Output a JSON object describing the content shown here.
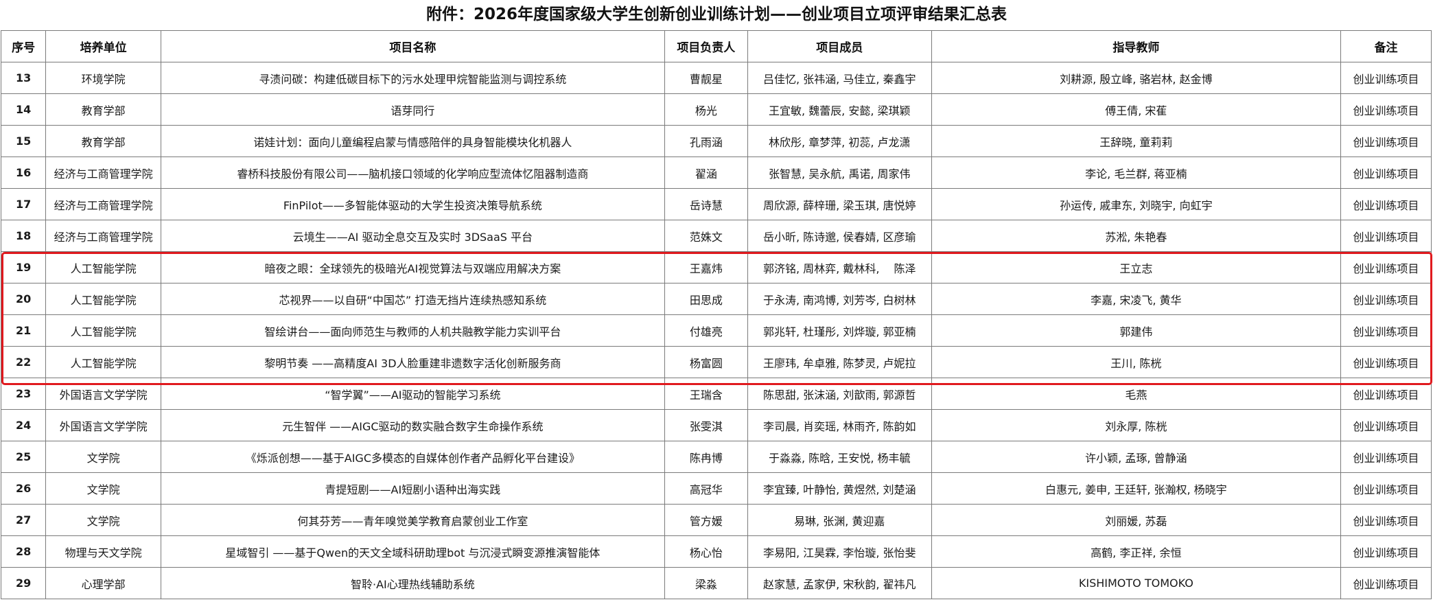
{
  "title": "附件：2026年度国家级大学生创新创业训练计划——创业项目立项评审结果汇总表",
  "headers": [
    "序号",
    "培养单位",
    "项目名称",
    "项目负责人",
    "项目成员",
    "指导教师",
    "备注"
  ],
  "rows": [
    {
      "seq": "13",
      "unit": "环境学院",
      "project": "寻渍问碳：构建低碳目标下的污水处理甲烷智能监测与调控系统",
      "leader": "曹靓星",
      "members": "吕佳忆, 张祎涵, 马佳立, 秦鑫宇",
      "advisors": "刘耕源, 殷立峰, 骆岩林, 赵金博",
      "remark": "创业训练项目"
    },
    {
      "seq": "14",
      "unit": "教育学部",
      "project": "语芽同行",
      "leader": "杨光",
      "members": "王宜敏, 魏蕾辰, 安懿, 梁琪颖",
      "advisors": "傅王倩, 宋萑",
      "remark": "创业训练项目"
    },
    {
      "seq": "15",
      "unit": "教育学部",
      "project": "诺娃计划：面向儿童编程启蒙与情感陪伴的具身智能模块化机器人",
      "leader": "孔雨涵",
      "members": "林欣彤, 章梦萍, 初蕊, 卢龙潇",
      "advisors": "王辞晓, 童莉莉",
      "remark": "创业训练项目"
    },
    {
      "seq": "16",
      "unit": "经济与工商管理学院",
      "project": "睿桥科技股份有限公司——脑机接口领域的化学响应型流体忆阻器制造商",
      "leader": "翟涵",
      "members": "张智慧, 吴永航, 禹诺, 周家伟",
      "advisors": "李论, 毛兰群, 蒋亚楠",
      "remark": "创业训练项目"
    },
    {
      "seq": "17",
      "unit": "经济与工商管理学院",
      "project": "FinPilot——多智能体驱动的大学生投资决策导航系统",
      "leader": "岳诗慧",
      "members": "周欣源, 薛梓珊, 梁玉琪, 唐悦婷",
      "advisors": "孙运传, 戚聿东, 刘晓宇, 向虹宇",
      "remark": "创业训练项目"
    },
    {
      "seq": "18",
      "unit": "经济与工商管理学院",
      "project": "云境生——AI 驱动全息交互及实时 3DSaaS 平台",
      "leader": "范姝文",
      "members": "岳小昕, 陈诗邈, 侯春婧, 区彦瑜",
      "advisors": "苏淞, 朱艳春",
      "remark": "创业训练项目"
    },
    {
      "seq": "19",
      "unit": "人工智能学院",
      "project": "暗夜之眼：全球领先的极暗光AI视觉算法与双端应用解决方案",
      "leader": "王嘉炜",
      "members": "郭济铭, 周林弈, 戴林科,　 陈泽",
      "advisors": "王立志",
      "remark": "创业训练项目"
    },
    {
      "seq": "20",
      "unit": "人工智能学院",
      "project": "芯视界——以自研“中国芯” 打造无挡片连续热感知系统",
      "leader": "田思成",
      "members": "于永涛, 南鸿博, 刘芳岑, 白树林",
      "advisors": "李嘉, 宋凌飞, 黄华",
      "remark": "创业训练项目"
    },
    {
      "seq": "21",
      "unit": "人工智能学院",
      "project": "智绘讲台——面向师范生与教师的人机共融教学能力实训平台",
      "leader": "付雄亮",
      "members": "郭兆轩, 杜瑾彤, 刘烨璇, 郭亚楠",
      "advisors": "郭建伟",
      "remark": "创业训练项目"
    },
    {
      "seq": "22",
      "unit": "人工智能学院",
      "project": "黎明节奏 ——高精度AI 3D人脸重建非遗数字活化创新服务商",
      "leader": "杨富圆",
      "members": "王廖玮, 牟卓雅, 陈梦灵, 卢妮拉",
      "advisors": "王川, 陈桄",
      "remark": "创业训练项目"
    },
    {
      "seq": "23",
      "unit": "外国语言文学学院",
      "project": "“智学翼”——AI驱动的智能学习系统",
      "leader": "王瑞含",
      "members": "陈思甜, 张沫涵, 刘歆雨, 郭源哲",
      "advisors": "毛燕",
      "remark": "创业训练项目"
    },
    {
      "seq": "24",
      "unit": "外国语言文学学院",
      "project": "元生智伴 ——AIGC驱动的数实融合数字生命操作系统",
      "leader": "张雯淇",
      "members": "李司晨, 肖奕瑶, 林雨齐, 陈韵如",
      "advisors": "刘永厚, 陈桄",
      "remark": "创业训练项目"
    },
    {
      "seq": "25",
      "unit": "文学院",
      "project": "《烁派创想——基于AIGC多模态的自媒体创作者产品孵化平台建设》",
      "leader": "陈冉博",
      "members": "于淼淼, 陈晗, 王安悦, 杨丰毓",
      "advisors": "许小颖, 孟琢, 曾静涵",
      "remark": "创业训练项目"
    },
    {
      "seq": "26",
      "unit": "文学院",
      "project": "青提短剧——AI短剧小语种出海实践",
      "leader": "高冠华",
      "members": "李宜臻, 叶静怡, 黄煜然, 刘楚涵",
      "advisors": "白惠元, 姜申, 王廷轩, 张瀚权, 杨晓宇",
      "remark": "创业训练项目"
    },
    {
      "seq": "27",
      "unit": "文学院",
      "project": "何其芬芳——青年嗅觉美学教育启蒙创业工作室",
      "leader": "管方媛",
      "members": "易琳, 张渊, 黄迎嘉",
      "advisors": "刘丽媛, 苏磊",
      "remark": "创业训练项目"
    },
    {
      "seq": "28",
      "unit": "物理与天文学院",
      "project": "星域智引 ——基于Qwen的天文全域科研助理bot 与沉浸式瞬变源推演智能体",
      "leader": "杨心怡",
      "members": "李易阳, 江昊霖, 李怡璇, 张怡斐",
      "advisors": "高鹤, 李正祥, 余恒",
      "remark": "创业训练项目"
    },
    {
      "seq": "29",
      "unit": "心理学部",
      "project": "智聆·AI心理热线辅助系统",
      "leader": "梁淼",
      "members": "赵家慧, 孟家伊, 宋秋韵, 翟祎凡",
      "advisors": "KISHIMOTO TOMOKO",
      "remark": "创业训练项目"
    }
  ],
  "highlight": {
    "color": "#e0191e",
    "rows": [
      "19",
      "20",
      "21",
      "22"
    ]
  }
}
